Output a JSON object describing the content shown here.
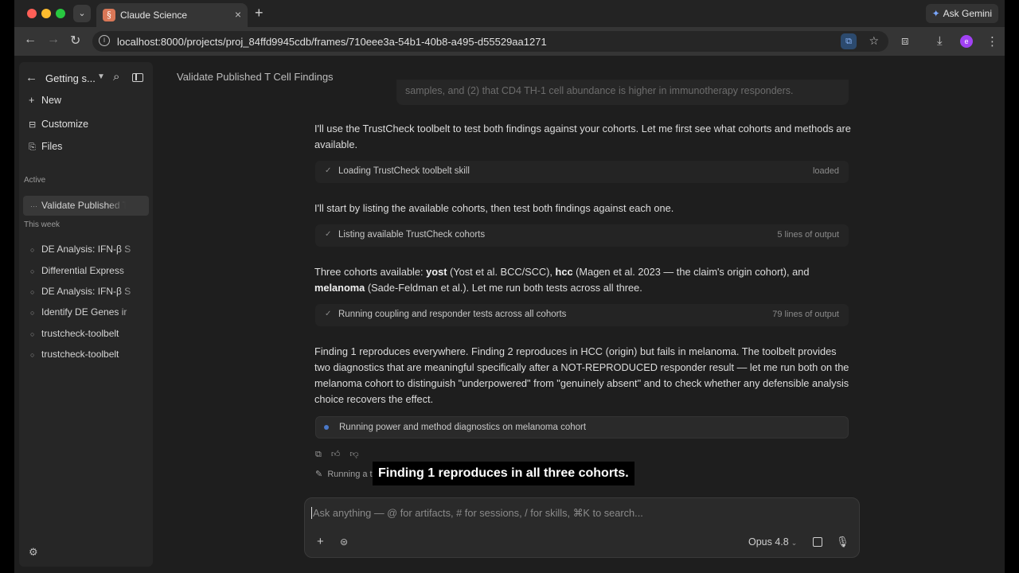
{
  "browser": {
    "tab_title": "Claude Science",
    "tab_close": "×",
    "new_tab": "+",
    "ask_gemini": "Ask Gemini",
    "url": "localhost:8000/projects/proj_84ffd9945cdb/frames/710eee3a-54b1-40b8-a495-d55529aa1271",
    "profile_initial": "e"
  },
  "sidebar": {
    "project": "Getting s...",
    "nav": [
      {
        "icon": "plus-icon",
        "label": "New"
      },
      {
        "icon": "customize-icon",
        "label": "Customize"
      },
      {
        "icon": "files-icon",
        "label": "Files"
      }
    ],
    "active_label": "Active",
    "active_item": "Validate Published T",
    "week_label": "This week",
    "week_items": [
      "DE Analysis: IFN-β S",
      "Differential Express",
      "DE Analysis: IFN-β S",
      "Identify DE Genes ir",
      "trustcheck-toolbelt",
      "trustcheck-toolbelt"
    ]
  },
  "main": {
    "title": "Validate Published T Cell Findings",
    "quote_tail": "samples, and (2) that CD4 TH-1 cell abundance is higher in immunotherapy responders.",
    "para1": "I'll use the TrustCheck toolbelt to test both findings against your cohorts. Let me first see what cohorts and methods are available.",
    "step1": {
      "label": "Loading TrustCheck toolbelt skill",
      "meta": "loaded"
    },
    "para2": "I'll start by listing the available cohorts, then test both findings against each one.",
    "step2": {
      "label": "Listing available TrustCheck cohorts",
      "meta": "5 lines of output"
    },
    "para3": {
      "pre": "Three cohorts available: ",
      "b1": "yost",
      "t1": " (Yost et al. BCC/SCC), ",
      "b2": "hcc",
      "t2": " (Magen et al. 2023 — the claim's origin cohort), and ",
      "b3": "melanoma",
      "t3": " (Sade-Feldman et al.). Let me run both tests across all three."
    },
    "step3": {
      "label": "Running coupling and responder tests across all cohorts",
      "meta": "79 lines of output"
    },
    "para4": "Finding 1 reproduces everywhere. Finding 2 reproduces in HCC (origin) but fails in melanoma. The toolbelt provides two diagnostics that are meaningful specifically after a NOT-REPRODUCED responder result — let me run both on the melanoma cohort to distinguish \"underpowered\" from \"genuinely absent\" and to check whether any defensible analysis choice recovers the effect.",
    "step4": {
      "label": "Running power and method diagnostics on melanoma cohort"
    },
    "status": "Running a t",
    "caption": "Finding 1 reproduces in all three cohorts."
  },
  "composer": {
    "placeholder": "Ask anything — @ for artifacts, # for sessions, / for skills, ⌘K to search...",
    "model": "Opus 4.8"
  },
  "colors": {
    "accent_running": "#4a78c8",
    "brand": "#d97757",
    "profile": "#a142f4"
  }
}
